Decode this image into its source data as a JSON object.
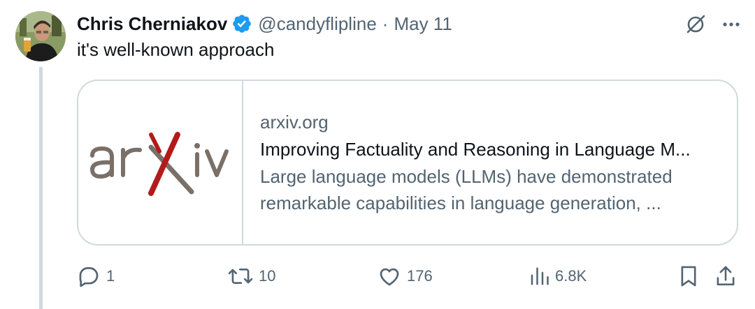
{
  "tweet": {
    "display_name": "Chris Cherniakov",
    "handle": "@candyflipline",
    "separator": "·",
    "date": "May 11",
    "text": "it's well-known approach",
    "verified": true
  },
  "card": {
    "logo_text": "arXiv",
    "domain": "arxiv.org",
    "title": "Improving Factuality and Reasoning in Language M...",
    "description_line1": "Large language models (LLMs) have demonstrated",
    "description_line2": "remarkable capabilities in language generation, ..."
  },
  "actions": {
    "replies": "1",
    "reposts": "10",
    "likes": "176",
    "views": "6.8K"
  },
  "icons": {
    "verified": "verified-badge-icon",
    "grok": "grok-icon",
    "more": "more-icon",
    "reply": "reply-icon",
    "repost": "repost-icon",
    "like": "like-icon",
    "views": "views-icon",
    "bookmark": "bookmark-icon",
    "share": "share-icon"
  },
  "colors": {
    "text_primary": "#0f1419",
    "text_secondary": "#536471",
    "border": "#cfd9de",
    "verified_blue": "#1d9bf0",
    "arxiv_red": "#b31b1b",
    "arxiv_gray": "#7a7068"
  }
}
